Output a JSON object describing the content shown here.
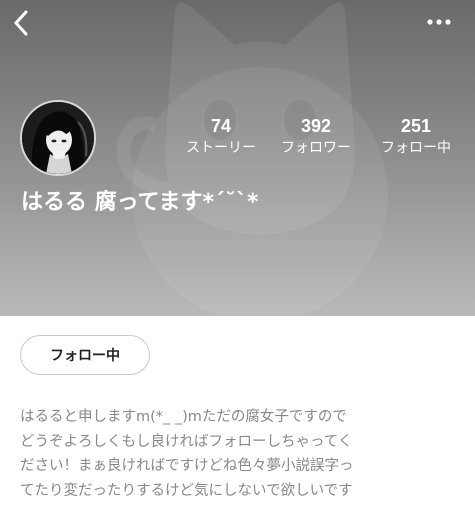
{
  "header": {
    "background_color": "#7a7a7a",
    "back_icon": "chevron-left-icon",
    "more_icon": "more-horizontal-icon",
    "watermark_icon": "cat-icon"
  },
  "profile": {
    "name": "はるる 腐ってます*´˘`*",
    "avatar": "anime-girl-avatar"
  },
  "stats": [
    {
      "value": "74",
      "label": "ストーリー"
    },
    {
      "value": "392",
      "label": "フォロワー"
    },
    {
      "value": "251",
      "label": "フォロー中"
    }
  ],
  "follow_button": {
    "label": "フォロー中"
  },
  "bio": {
    "lines": [
      "はるると申しますm(*_ _)mただの腐女子ですので",
      "どうぞよろしくもし良ければフォローしちゃってく",
      "ださい！まぁ良ければですけどね色々夢小説誤字っ",
      "てたり変だったりするけど気にしないで欲しいです"
    ]
  }
}
